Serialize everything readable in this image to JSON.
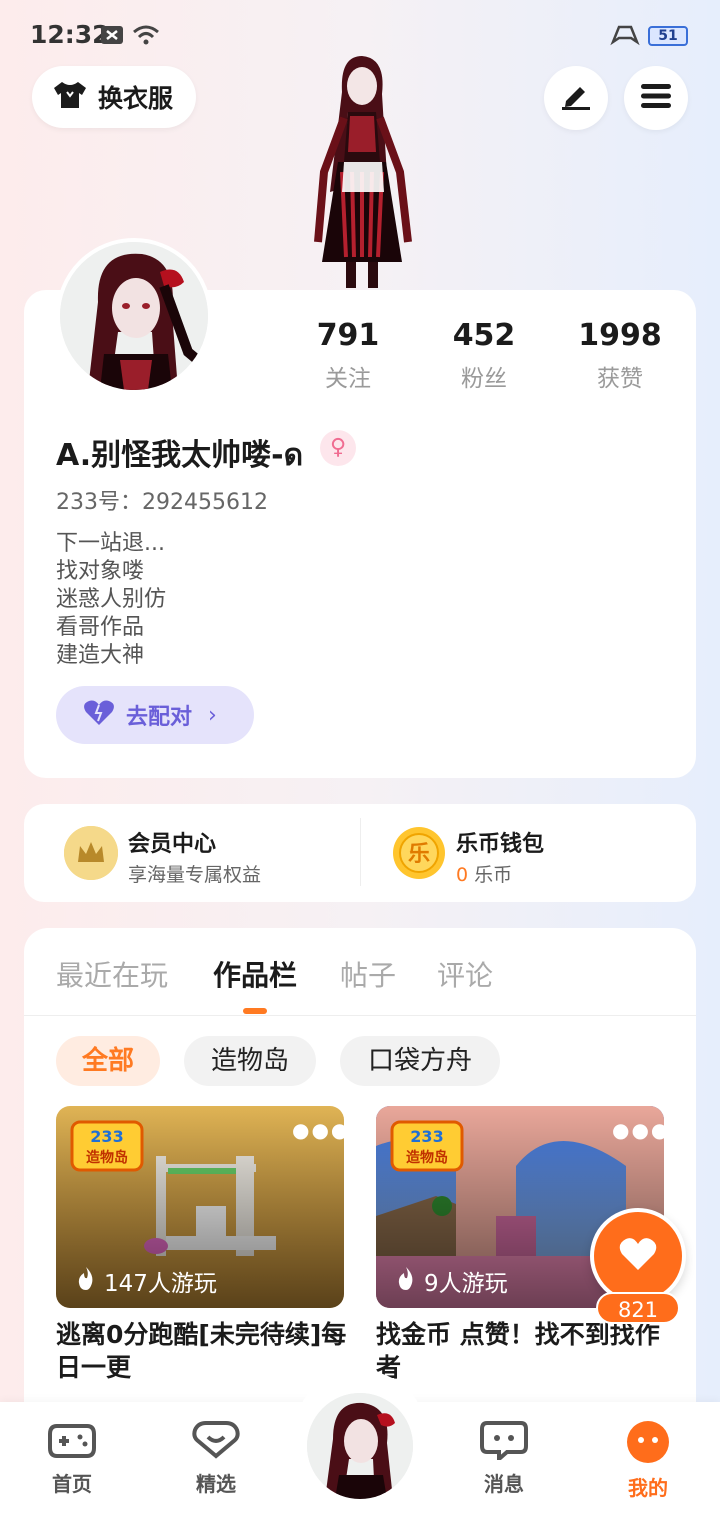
{
  "status_bar": {
    "time": "12:32",
    "battery": "51"
  },
  "top": {
    "outfit_label": "换衣服"
  },
  "profile": {
    "stats": [
      {
        "num": "791",
        "label": "关注"
      },
      {
        "num": "452",
        "label": "粉丝"
      },
      {
        "num": "1998",
        "label": "获赞"
      }
    ],
    "username": "A.别怪我太帅喽-ด",
    "uid": "233号：292455612",
    "bio": [
      "下一站退...",
      "找对象喽",
      "迷惑人别仿",
      "看哥作品",
      "建造大神"
    ],
    "match_label": "去配对"
  },
  "member": {
    "title": "会员中心",
    "sub": "享海量专属权益"
  },
  "wallet": {
    "title": "乐币钱包",
    "amount": "0",
    "unit": "乐币",
    "icon_char": "乐"
  },
  "tabs": [
    "最近在玩",
    "作品栏",
    "帖子",
    "评论"
  ],
  "chips": [
    "全部",
    "造物岛",
    "口袋方舟"
  ],
  "works": [
    {
      "badge": "233",
      "badge_sub": "造物岛",
      "plays": "147人游玩",
      "title": "逃离0分跑酷[未完待续]每日一更"
    },
    {
      "badge": "233",
      "badge_sub": "造物岛",
      "plays": "9人游玩",
      "title": "找金币 点赞！找不到找作者"
    }
  ],
  "like": {
    "count": "821"
  },
  "nav": [
    {
      "label": "首页"
    },
    {
      "label": "精选"
    },
    {
      "label": "消息"
    },
    {
      "label": "我的"
    }
  ],
  "colors": {
    "accent": "#ff6d1b",
    "match": "#6a5fd9"
  }
}
